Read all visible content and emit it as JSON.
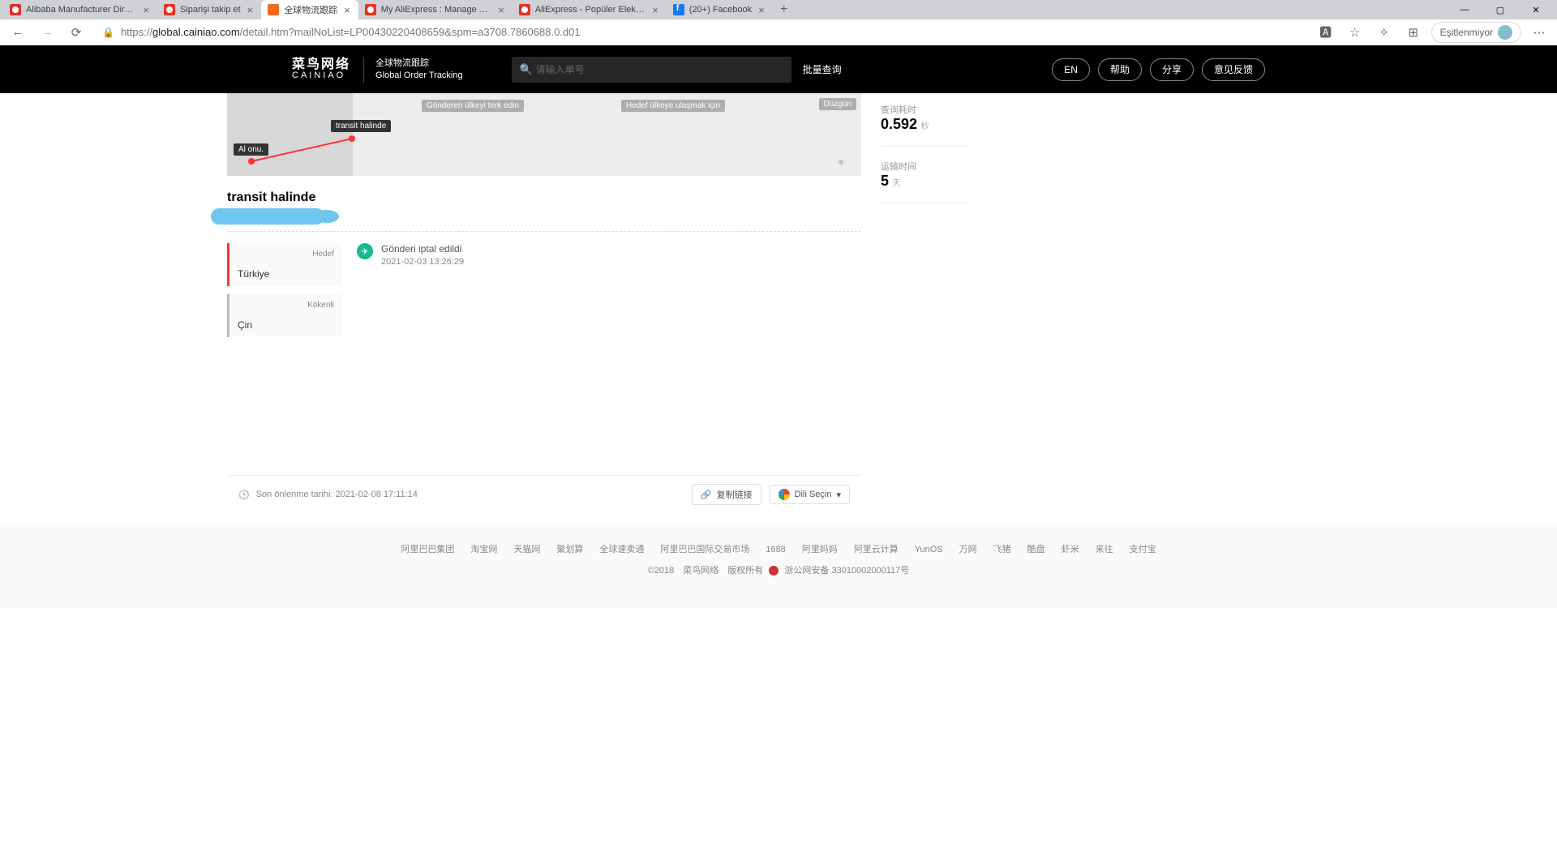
{
  "browser": {
    "tabs": [
      {
        "title": "Alibaba Manufacturer Directory"
      },
      {
        "title": "Siparişi takip et"
      },
      {
        "title": "全球物流跟踪",
        "active": true
      },
      {
        "title": "My AliExpress : Manage Orders"
      },
      {
        "title": "AliExpress - Popüler Elektronik, M"
      },
      {
        "title": "(20+) Facebook"
      }
    ],
    "url_host": "global.cainiao.com",
    "url_path": "/detail.htm?mailNoList=LP00430220408659&spm=a3708.7860688.0.d01",
    "sync_label": "Eşitlenmiyor"
  },
  "header": {
    "logo_zh": "菜鸟网络",
    "logo_en": "CAINIAO",
    "subtitle_zh": "全球物流跟踪",
    "subtitle_en": "Global Order Tracking",
    "search_placeholder": "请输入单号",
    "batch": "批量查询",
    "btn_lang": "EN",
    "btn_help": "帮助",
    "btn_share": "分享",
    "btn_feedback": "意见反馈"
  },
  "progress": {
    "pickup": "Al onu.",
    "current": "transit halinde",
    "leave_origin": "Gönderen ülkeyi terk edin",
    "arrive_dest": "Hedef ülkeye ulaşmak için",
    "delivered": "Düzgün"
  },
  "status": {
    "title": "transit halinde"
  },
  "dest": {
    "label": "Hedef",
    "value": "Türkiye"
  },
  "origin": {
    "label": "Kökenli",
    "value": "Çin"
  },
  "event": {
    "text": "Gönderi iptal edildi",
    "time": "2021-02-03 13:26:29"
  },
  "bottom": {
    "last_check": "Son önlenme tarihi: 2021-02-08 17:11:14",
    "copy_link": "复制链接",
    "lang_select": "Dili Seçin"
  },
  "side": {
    "query_label": "查询耗时",
    "query_value": "0.592",
    "query_unit": "秒",
    "transit_label": "运输时间",
    "transit_value": "5",
    "transit_unit": "天"
  },
  "footer": {
    "links": [
      "阿里巴巴集团",
      "淘宝网",
      "天猫网",
      "聚划算",
      "全球速卖通",
      "阿里巴巴国际交易市场",
      "1688",
      "阿里妈妈",
      "阿里云计算",
      "YunOS",
      "万网",
      "飞猪",
      "酷盘",
      "虾米",
      "来往",
      "支付宝"
    ],
    "copyright": "©2018　菜鸟网络　版权所有",
    "beian": "浙公网安备 33010002000117号"
  }
}
